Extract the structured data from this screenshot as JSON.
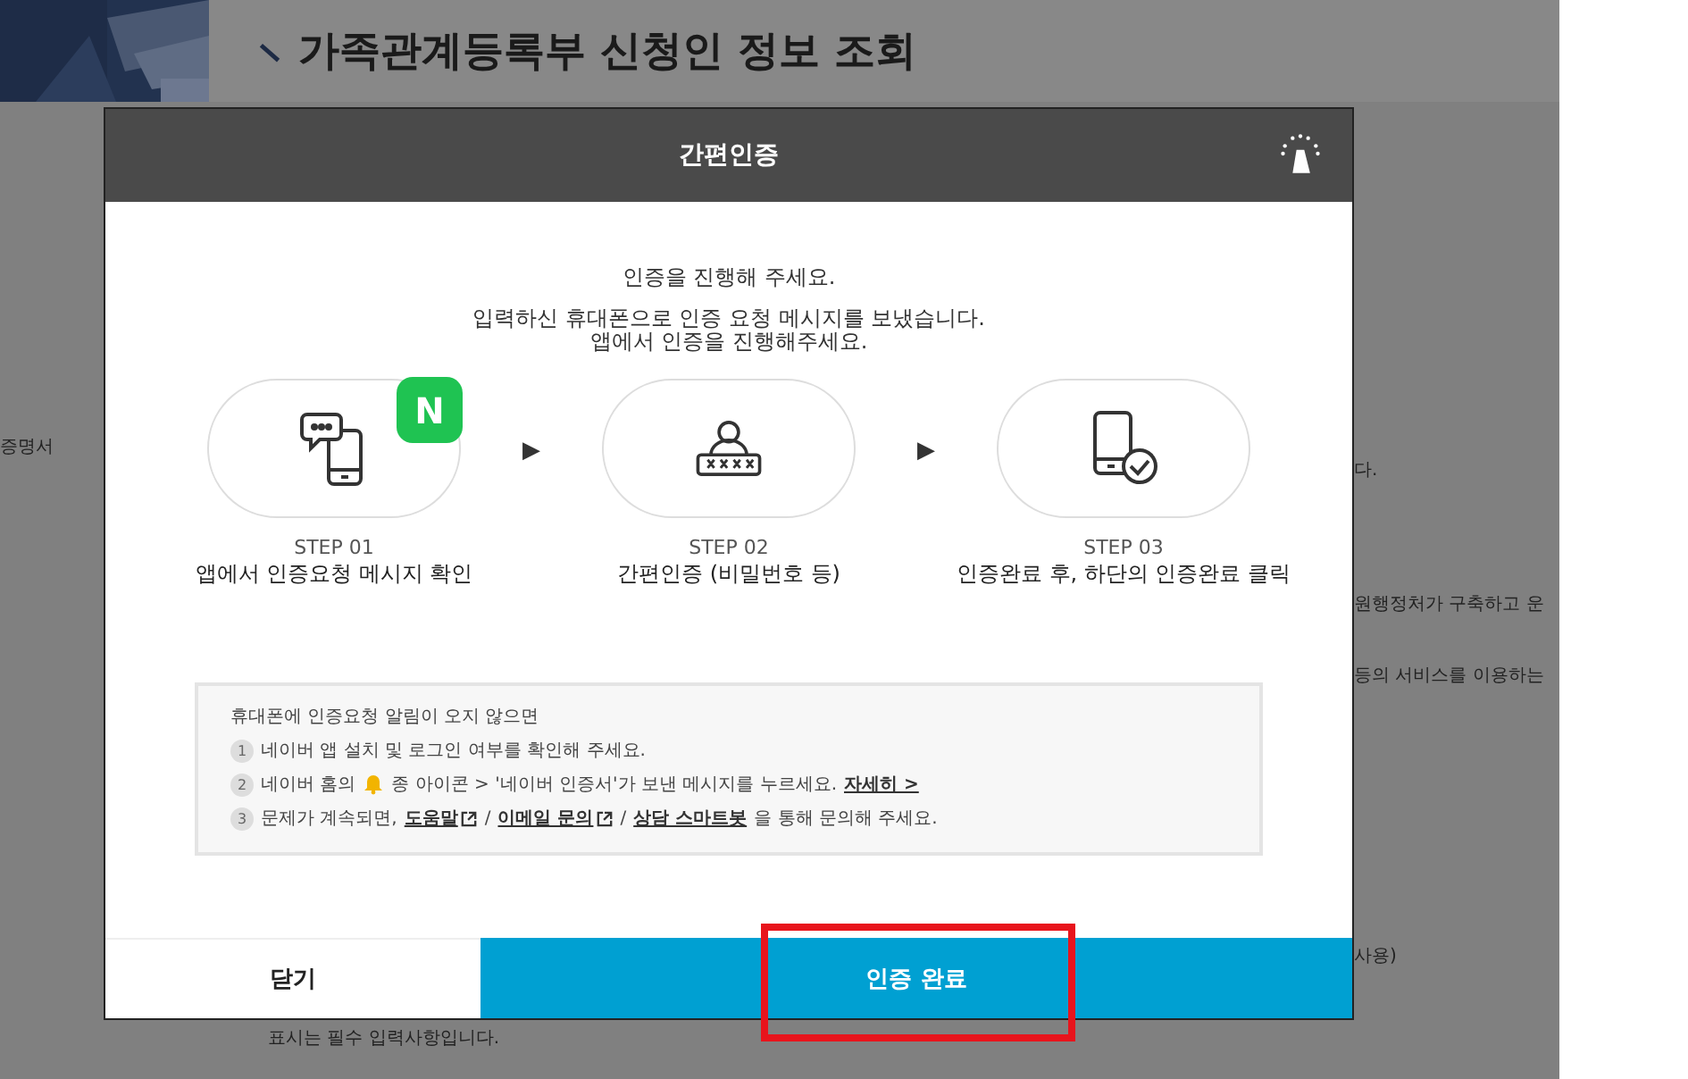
{
  "page": {
    "title": "가족관계등록부 신청인 정보 조회",
    "background_texts": [
      {
        "text": "증명서",
        "kind": "left"
      },
      {
        "text": "다.",
        "kind": "right"
      },
      {
        "text": "원행정처가 구축하고 운",
        "kind": "right"
      },
      {
        "text": "등의 서비스를 이용하는",
        "kind": "right"
      },
      {
        "text": "사용)",
        "kind": "right"
      },
      {
        "text": "표시는 필수 입력사항입니다.",
        "kind": "bottom"
      }
    ]
  },
  "modal": {
    "title": "간편인증",
    "intro": [
      "인증을 진행해 주세요.",
      "입력하신 휴대폰으로 인증 요청 메시지를 보냈습니다.",
      "앱에서 인증을 진행해주세요."
    ],
    "badge": "N",
    "steps": [
      {
        "number": "STEP 01",
        "label": "앱에서 인증요청 메시지 확인",
        "kind": "message"
      },
      {
        "number": "STEP 02",
        "label": "간편인증 (비밀번호 등)",
        "kind": "password"
      },
      {
        "number": "STEP 03",
        "label": "인증완료 후, 하단의 인증완료 클릭",
        "kind": "verified"
      }
    ],
    "arrow": "▶",
    "help": {
      "title": "휴대폰에 인증요청 알림이 오지 않으면",
      "items": [
        {
          "number": "1",
          "parts": [
            {
              "text": "네이버 앱 설치 및 로그인 여부를 확인해 주세요.",
              "kind": "text"
            }
          ]
        },
        {
          "number": "2",
          "parts": [
            {
              "text": "네이버 홈의",
              "kind": "text"
            },
            {
              "kind": "bell"
            },
            {
              "text": "종 아이콘 > '네이버 인증서'가 보낸 메시지를 누르세요.",
              "kind": "text"
            },
            {
              "text": "자세히 >",
              "kind": "link"
            }
          ]
        },
        {
          "number": "3",
          "parts": [
            {
              "text": "문제가 계속되면,",
              "kind": "text"
            },
            {
              "text": "도움말",
              "kind": "extlink"
            },
            {
              "text": "/",
              "kind": "text"
            },
            {
              "text": "이메일 문의",
              "kind": "extlink"
            },
            {
              "text": "/",
              "kind": "text"
            },
            {
              "text": "상담 스마트봇",
              "kind": "link"
            },
            {
              "text": "을 통해 문의해 주세요.",
              "kind": "text"
            }
          ]
        }
      ]
    },
    "buttons": [
      {
        "label": "닫기",
        "kind": "secondary",
        "highlighted": false
      },
      {
        "label": "인증 완료",
        "kind": "primary",
        "highlighted": true
      }
    ]
  }
}
